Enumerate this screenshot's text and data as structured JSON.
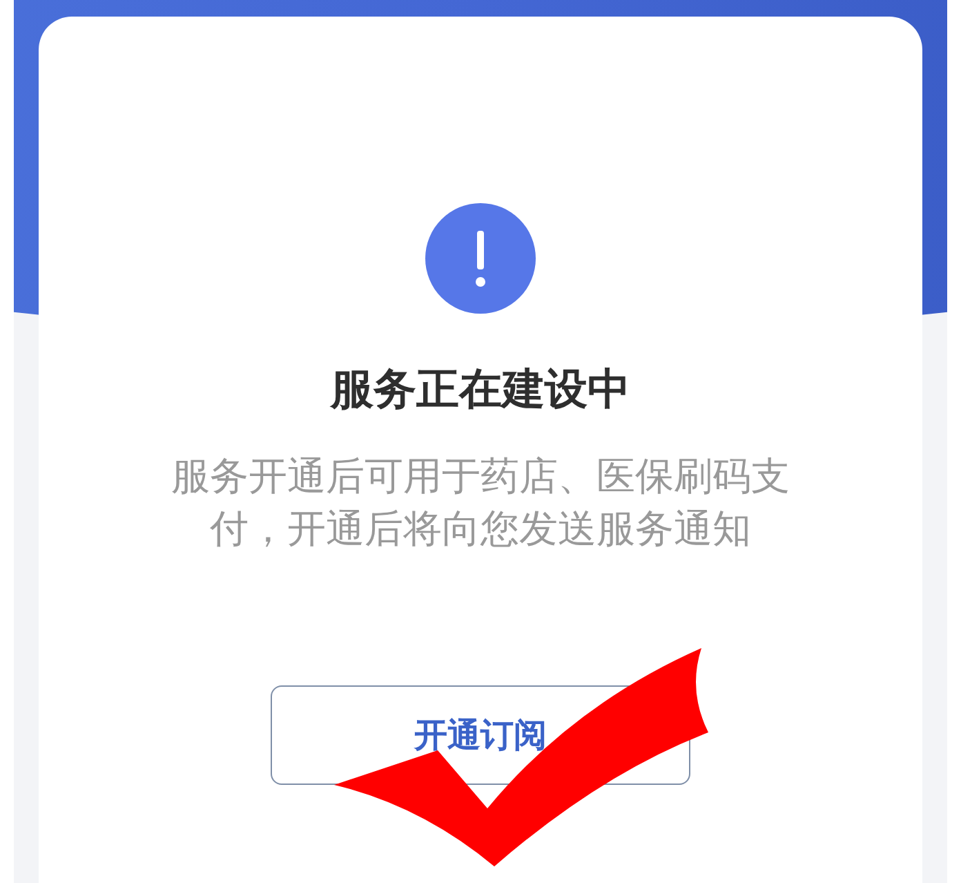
{
  "notice": {
    "title": "服务正在建设中",
    "description": "服务开通后可用于药店、医保刷码支付，开通后将向您发送服务通知",
    "button": {
      "label": "开通订阅"
    }
  }
}
